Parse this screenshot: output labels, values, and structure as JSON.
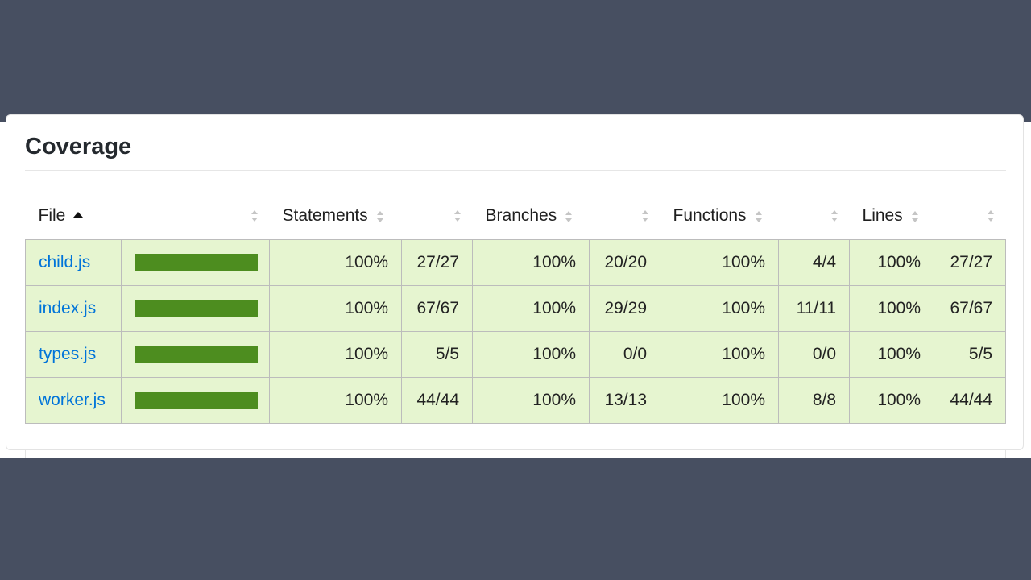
{
  "page": {
    "title": "Coverage",
    "background_color": "#474f61",
    "row_fill_color": "#e6f5d0",
    "bar_color": "#4d8d1f",
    "link_color": "#0074d9"
  },
  "table": {
    "headers": {
      "file": "File",
      "statements": "Statements",
      "branches": "Branches",
      "functions": "Functions",
      "lines": "Lines"
    },
    "sort": {
      "column": "File",
      "direction": "ascending"
    },
    "rows": [
      {
        "file": "child.js",
        "coverage_fraction": 1.0,
        "statements_pct": "100%",
        "statements_count": "27/27",
        "branches_pct": "100%",
        "branches_count": "20/20",
        "functions_pct": "100%",
        "functions_count": "4/4",
        "lines_pct": "100%",
        "lines_count": "27/27"
      },
      {
        "file": "index.js",
        "coverage_fraction": 1.0,
        "statements_pct": "100%",
        "statements_count": "67/67",
        "branches_pct": "100%",
        "branches_count": "29/29",
        "functions_pct": "100%",
        "functions_count": "11/11",
        "lines_pct": "100%",
        "lines_count": "67/67"
      },
      {
        "file": "types.js",
        "coverage_fraction": 1.0,
        "statements_pct": "100%",
        "statements_count": "5/5",
        "branches_pct": "100%",
        "branches_count": "0/0",
        "functions_pct": "100%",
        "functions_count": "0/0",
        "lines_pct": "100%",
        "lines_count": "5/5"
      },
      {
        "file": "worker.js",
        "coverage_fraction": 1.0,
        "statements_pct": "100%",
        "statements_count": "44/44",
        "branches_pct": "100%",
        "branches_count": "13/13",
        "functions_pct": "100%",
        "functions_count": "8/8",
        "lines_pct": "100%",
        "lines_count": "44/44"
      }
    ]
  }
}
